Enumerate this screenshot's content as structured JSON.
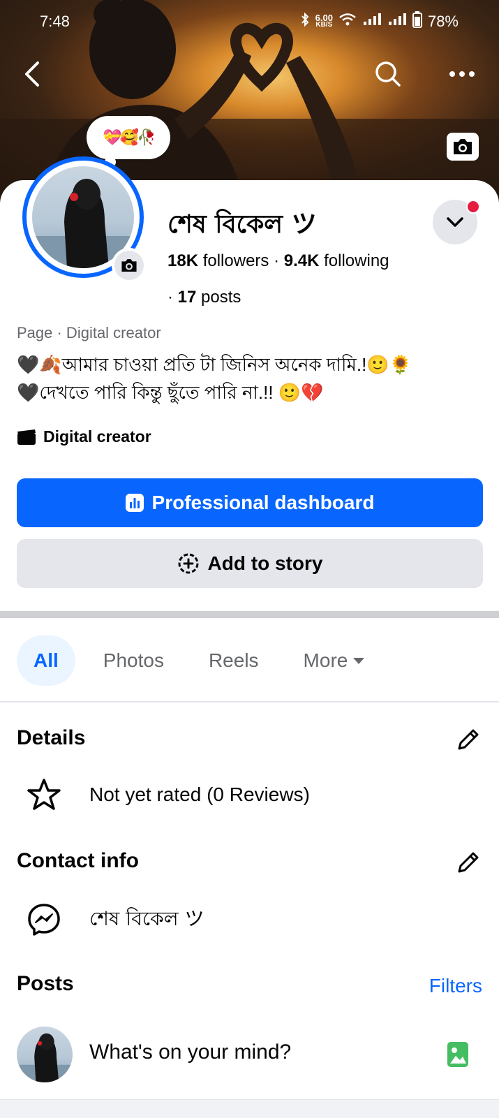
{
  "status_bar": {
    "time": "7:48",
    "net_speed_top": "6.00",
    "net_speed_unit": "KB/S",
    "battery": "78%"
  },
  "header": {
    "icons": [
      "back-icon",
      "search-icon",
      "more-icon",
      "camera-icon"
    ]
  },
  "note": {
    "text": "💝🥰🥀"
  },
  "profile": {
    "name": "শেষ বিকেল ツ",
    "followers_count": "18K",
    "followers_label": "followers",
    "following_count": "9.4K",
    "following_label": "following",
    "posts_prefix": "· ",
    "posts_count": "17",
    "posts_label": "posts",
    "separator": "·",
    "category": "Page · Digital creator",
    "bio_line1": "🖤🍂আমার চাওয়া প্রতি টা জিনিস অনেক দামি.!🙂🌻",
    "bio_line2": "🖤দেখতে পারি কিন্তু ছুঁতে পারি না.!! 🙂💔",
    "creator_label": "Digital creator"
  },
  "buttons": {
    "professional_dashboard": "Professional dashboard",
    "add_to_story": "Add to story"
  },
  "tabs": [
    {
      "label": "All",
      "active": true
    },
    {
      "label": "Photos",
      "active": false
    },
    {
      "label": "Reels",
      "active": false
    },
    {
      "label": "More",
      "active": false
    }
  ],
  "details": {
    "title": "Details",
    "rating": "Not yet rated (0 Reviews)"
  },
  "contact": {
    "title": "Contact info",
    "messenger_name": "শেষ বিকেল ツ"
  },
  "posts": {
    "title": "Posts",
    "filters": "Filters",
    "composer_placeholder": "What's on your mind?"
  },
  "colors": {
    "accent": "#0866ff",
    "button_grey": "#e4e6eb",
    "secondary_text": "#65676b",
    "notification": "#e41e3f"
  }
}
